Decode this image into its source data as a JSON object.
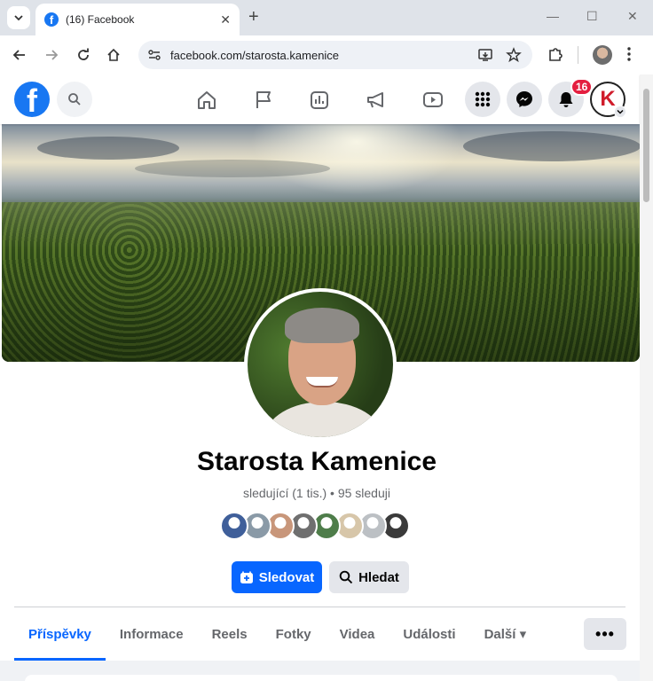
{
  "browser": {
    "tab_title": "(16) Facebook",
    "tab_close": "✕",
    "new_tab": "+",
    "url": "facebook.com/starosta.kamenice",
    "window_controls": [
      "—",
      "☐",
      "✕"
    ]
  },
  "fb_nav": {
    "logo_letter": "f",
    "notification_count": "16",
    "profile_initial": "K"
  },
  "profile": {
    "name": "Starosta Kamenice",
    "stats": "sledující (1 tis.) • 95 sleduji",
    "follower_avatar_colors": [
      "#3f5f9a",
      "#8a9aa7",
      "#c8967a",
      "#6f6f6f",
      "#4e7d4a",
      "#d7c6a9",
      "#bcc0c4",
      "#3a3a3a"
    ],
    "follow_button": "Sledovat",
    "search_button": "Hledat"
  },
  "tabs": [
    {
      "label": "Příspěvky",
      "active": true
    },
    {
      "label": "Informace",
      "active": false
    },
    {
      "label": "Reels",
      "active": false
    },
    {
      "label": "Fotky",
      "active": false
    },
    {
      "label": "Videa",
      "active": false
    },
    {
      "label": "Události",
      "active": false
    },
    {
      "label": "Další ▾",
      "active": false
    }
  ],
  "more_button": "•••",
  "colors": {
    "brand": "#1877f2",
    "primary_button": "#0866ff",
    "badge": "#e41e3f"
  }
}
